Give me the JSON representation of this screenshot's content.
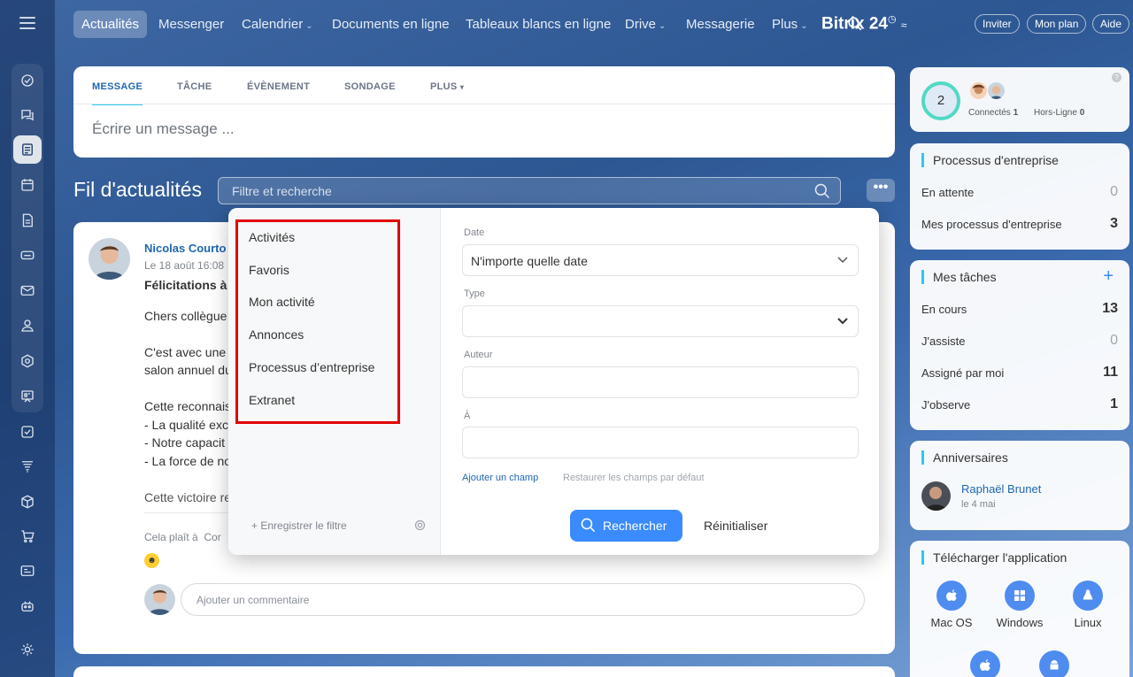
{
  "topnav": {
    "items": [
      "Actualités",
      "Messenger",
      "Calendrier",
      "Documents en ligne",
      "Tableaux blancs en ligne",
      "Drive",
      "Messagerie",
      "Plus"
    ],
    "brand": "Bitrix 24",
    "invite": "Inviter",
    "plan": "Mon plan",
    "help": "Aide"
  },
  "composer": {
    "tabs": [
      "MESSAGE",
      "TÂCHE",
      "ÉVÈNEMENT",
      "SONDAGE",
      "PLUS"
    ],
    "placeholder": "Écrire un message ..."
  },
  "feed": {
    "title": "Fil d'actualités",
    "search_placeholder": "Filtre et recherche"
  },
  "post": {
    "author": "Nicolas Courto",
    "date": "Le 18 août 16:08",
    "title": "Félicitations à",
    "lines": [
      "Chers collègue",
      "C'est avec une",
      "salon annuel du",
      "Cette reconnais",
      "- La qualité exc",
      "- Notre capacit",
      "- La force de no"
    ],
    "victory": "Cette victoire re",
    "like": "Cela plaît à",
    "like_more": "Cor",
    "comment_placeholder": "Ajouter un commentaire"
  },
  "filter": {
    "presets": [
      "Activités",
      "Favoris",
      "Mon activité",
      "Annonces",
      "Processus d’entreprise",
      "Extranet"
    ],
    "save_filter": "+ Enregistrer le filtre",
    "fields": {
      "date_label": "Date",
      "date_value": "N'importe quelle date",
      "type_label": "Type",
      "author_label": "Auteur",
      "to_label": "À"
    },
    "add_field": "Ajouter un champ",
    "restore": "Restaurer les champs par défaut",
    "search_button": "Rechercher",
    "reset_button": "Réinitialiser"
  },
  "widgets": {
    "online": {
      "count": "2",
      "connected_label": "Connectés",
      "connected_count": "1",
      "offline_label": "Hors-Ligne",
      "offline_count": "0"
    },
    "processes": {
      "title": "Processus d'entreprise",
      "rows": [
        {
          "label": "En attente",
          "value": "0"
        },
        {
          "label": "Mes processus d'entreprise",
          "value": "3"
        }
      ]
    },
    "tasks": {
      "title": "Mes tâches",
      "add": "+",
      "rows": [
        {
          "label": "En cours",
          "value": "13"
        },
        {
          "label": "J'assiste",
          "value": "0"
        },
        {
          "label": "Assigné par moi",
          "value": "11"
        },
        {
          "label": "J'observe",
          "value": "1"
        }
      ]
    },
    "birthdays": {
      "title": "Anniversaires",
      "name": "Raphaël Brunet",
      "date": "le 4 mai"
    },
    "download": {
      "title": "Télécharger l'application",
      "platforms": [
        "Mac OS",
        "Windows",
        "Linux"
      ]
    }
  },
  "colors": {
    "accent": "#2fc6f6",
    "primary_button": "#3a8bfd",
    "highlight_border": "#e00000",
    "link": "#2067b0"
  }
}
